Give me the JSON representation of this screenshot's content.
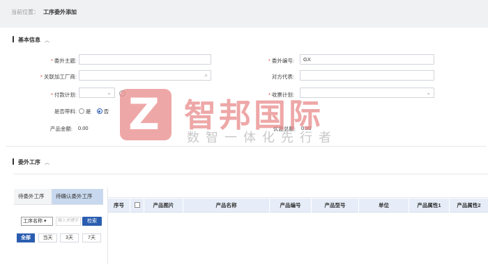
{
  "breadcrumb": {
    "label": "当前位置：",
    "current": "工序委外添加"
  },
  "basic_info": {
    "title": "基本信息",
    "fields": {
      "subject": {
        "label": "委外主题:",
        "required": true,
        "value": ""
      },
      "number": {
        "label": "委外编号:",
        "required": true,
        "value": "GX"
      },
      "factory": {
        "label": "关联加工厂商:",
        "required": true,
        "value": ""
      },
      "counterpart_rep": {
        "label": "对方代表:",
        "required": false,
        "value": ""
      },
      "payment_plan": {
        "label": "付款计划:",
        "required": true,
        "value": ""
      },
      "receipt_plan": {
        "label": "收票计划:",
        "required": true,
        "value": ""
      },
      "with_material": {
        "label": "是否带料:",
        "options": [
          "是",
          "否"
        ],
        "selected": "否"
      },
      "product_amount": {
        "label": "产品金额:",
        "value": "0.00"
      },
      "discount_total": {
        "label": "优惠总额:",
        "value": "0.00"
      }
    }
  },
  "outsource_process": {
    "title": "委外工序",
    "tabs": [
      "待委外工序",
      "待确认委外工序"
    ],
    "active_tab": "待确认委外工序",
    "filter": {
      "select_value": "工序名称",
      "input_placeholder": "输入关键字",
      "search_label": "检索"
    },
    "quick_filters": [
      "全部",
      "当天",
      "3天",
      "7天"
    ],
    "active_quick_filter": "全部",
    "columns": [
      "序号",
      "",
      "产品图片",
      "产品名称",
      "产品编号",
      "产品型号",
      "单位",
      "产品属性1",
      "产品属性2"
    ]
  },
  "watermark": {
    "logo_letter": "Z",
    "title": "智邦国际",
    "subtitle": "数智一体化先行者"
  },
  "colors": {
    "accent": "#2a5db0",
    "required": "#e23b3b",
    "header_bg": "#e6edf8",
    "watermark": "#e98a8a"
  }
}
